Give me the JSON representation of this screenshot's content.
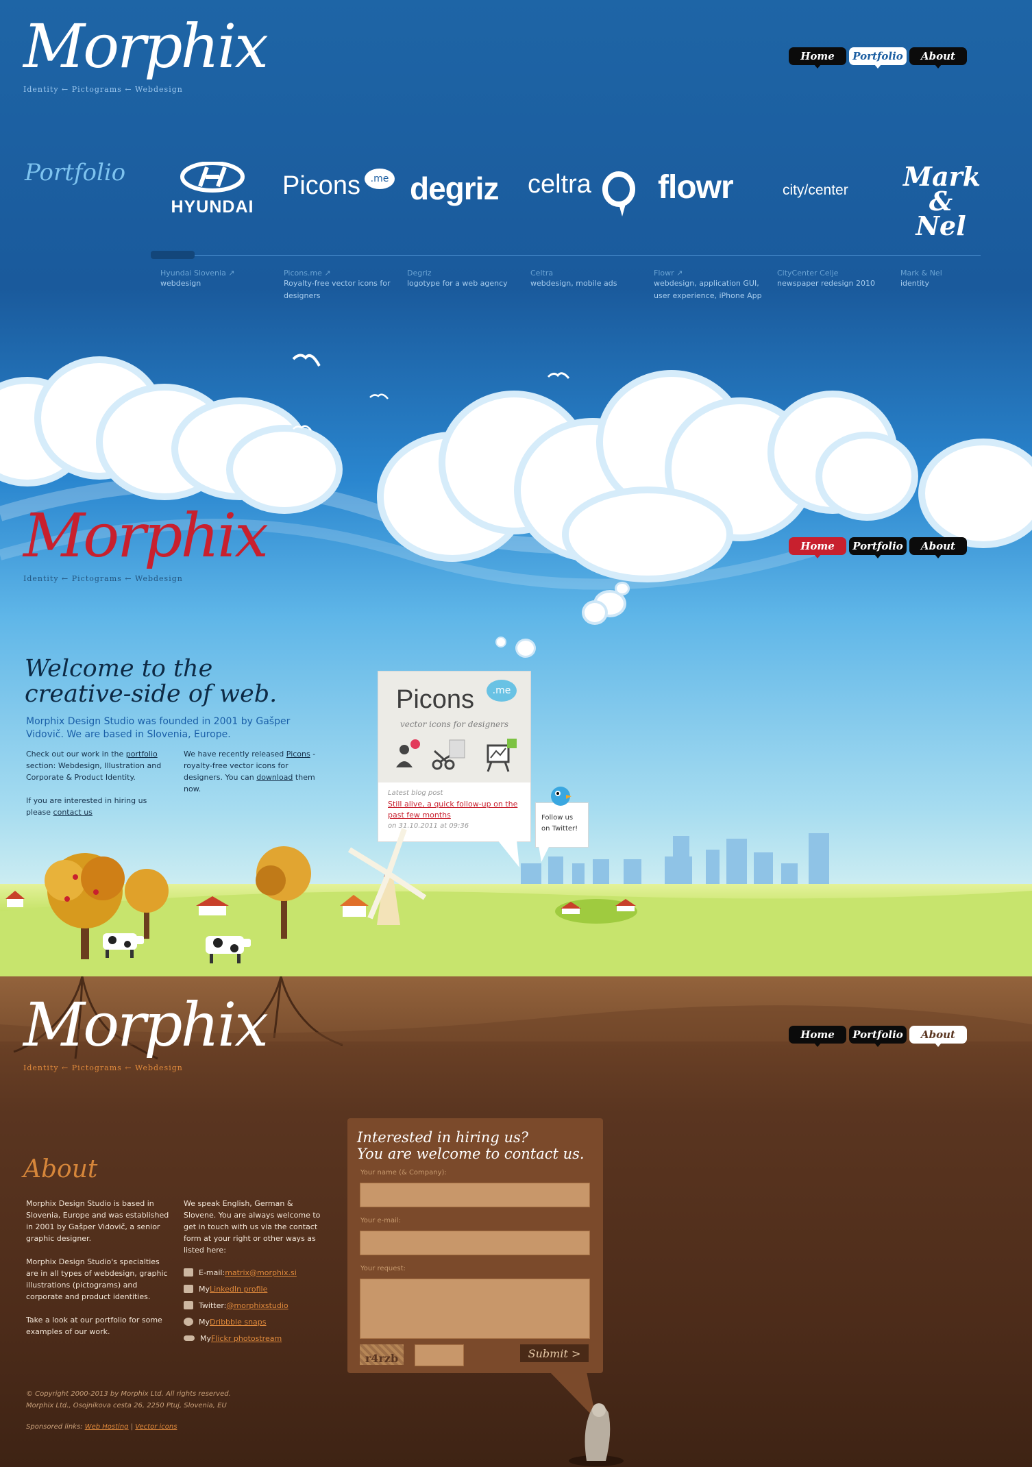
{
  "logo": {
    "name": "Morphix",
    "tagline": "Identity ← Pictograms ← Webdesign"
  },
  "nav": {
    "home": "Home",
    "portfolio": "Portfolio",
    "about": "About"
  },
  "portfolio": {
    "title": "Portfolio",
    "logos": [
      "HYUNDAI",
      "Picons",
      ".me",
      "degriz",
      "celtra",
      "flowr",
      "city/center",
      "Mark & Nel"
    ],
    "items": [
      {
        "name": "Hyundai Slovenia ↗",
        "desc": "webdesign"
      },
      {
        "name": "Picons.me ↗",
        "desc": "Royalty-free vector icons for designers"
      },
      {
        "name": "Degriz",
        "desc": "logotype for a web agency"
      },
      {
        "name": "Celtra",
        "desc": "webdesign, mobile ads"
      },
      {
        "name": "Flowr ↗",
        "desc": "webdesign, application GUI, user experience, iPhone App"
      },
      {
        "name": "CityCenter Celje",
        "desc": "newspaper redesign 2010"
      },
      {
        "name": "Mark & Nel",
        "desc": "identity"
      }
    ]
  },
  "welcome": {
    "heading_line1": "Welcome to the",
    "heading_line2": "creative-side of web.",
    "lead": "Morphix Design Studio was founded in 2001 by Gašper Vidovič. We are based in Slovenia, Europe.",
    "col1_before": "Check out our work in the ",
    "col1_link": "portfolio",
    "col1_after": " section: Webdesign, Illustration and Corporate & Product Identity.",
    "col1_hire": "If you are interested in hiring us please ",
    "col1_hire_link": "contact us",
    "col2_before": "We have recently released ",
    "col2_link": "Picons",
    "col2_mid": " - royalty-free vector icons for designers. You can ",
    "col2_link2": "download",
    "col2_after": " them now."
  },
  "picons_card": {
    "title": "Picons",
    "badge": ".me",
    "subtitle": "vector icons for designers",
    "blog_label": "Latest blog post",
    "blog_link": "Still alive, a quick follow-up on the past few months",
    "blog_date": "on 31.10.2011 at 09:36"
  },
  "twitter": {
    "text": "Follow us on Twitter!"
  },
  "about": {
    "title": "About",
    "col1_p1": "Morphix Design Studio is based in Slovenia, Europe and was established in 2001 by Gašper Vidovič, a senior graphic designer.",
    "col1_p2": "Morphix Design Studio's specialties are in all types of webdesign, graphic illustrations (pictograms) and corporate and product identities.",
    "col1_p3": "Take a look at our portfolio for some examples of our work.",
    "col2_p1": "We speak English, German & Slovene. You are always welcome to get in touch with us via the contact form at your right or other ways as listed here:",
    "contacts": [
      {
        "prefix": "E-mail: ",
        "link": "matrix@morphix.si",
        "icon": "mail-icon"
      },
      {
        "prefix": "My ",
        "link": "LinkedIn profile",
        "icon": "linkedin-icon"
      },
      {
        "prefix": "Twitter: ",
        "link": "@morphixstudio",
        "icon": "twitter-icon"
      },
      {
        "prefix": "My ",
        "link": "Dribbble snaps",
        "icon": "dribbble-icon"
      },
      {
        "prefix": "My ",
        "link": "Flickr photostream",
        "icon": "flickr-icon"
      }
    ]
  },
  "form": {
    "heading_line1": "Interested in hiring us?",
    "heading_line2": "You are welcome to contact us.",
    "label_name": "Your name (& Company):",
    "label_email": "Your e-mail:",
    "label_request": "Your request:",
    "captcha": "r4rzb",
    "submit": "Submit >"
  },
  "footer": {
    "copyright": "© Copyright 2000-2013 by Morphix Ltd. All rights reserved.",
    "address": "Morphix Ltd., Osojnikova cesta 26, 2250 Ptuj, Slovenia, EU",
    "sponsored_label": "Sponsored links: ",
    "link1": "Web Hosting",
    "separator": " | ",
    "link2": "Vector icons"
  },
  "colors": {
    "sky_top": "#1e65a6",
    "nav_dark": "#0b0b0b",
    "nav_red": "#c8202e",
    "about_orange": "#d6863a",
    "soil": "#5a3520"
  }
}
